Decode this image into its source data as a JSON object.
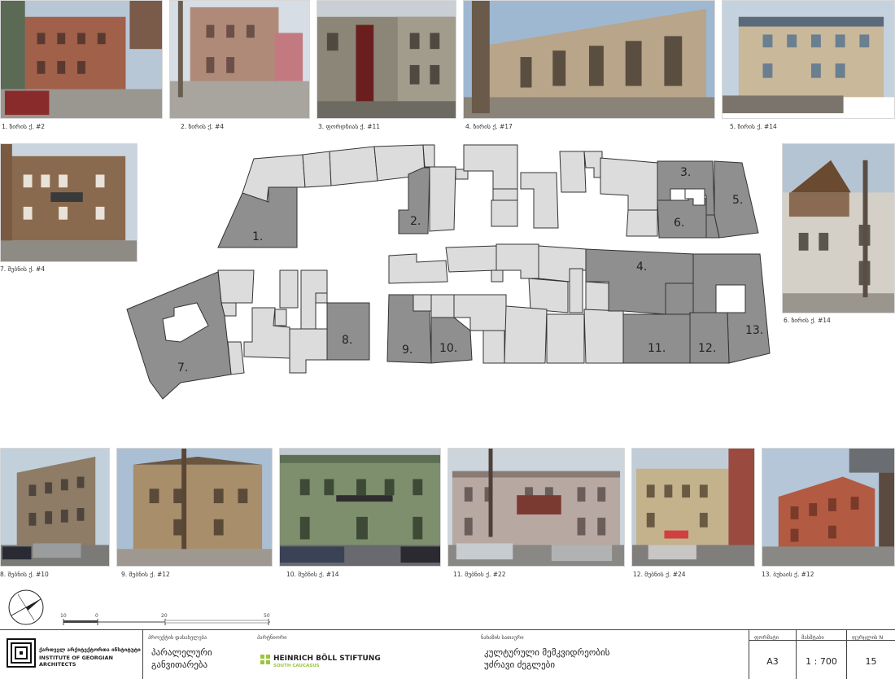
{
  "photos": [
    {
      "num": "1",
      "caption": "1. ზირის ქ. #2"
    },
    {
      "num": "2",
      "caption": "2. ზირის ქ. #4"
    },
    {
      "num": "3",
      "caption": "3. ფორდნიას ქ. #11"
    },
    {
      "num": "4",
      "caption": "4. ზირის ქ. #17"
    },
    {
      "num": "5",
      "caption": "5. ზირის ქ. #14"
    },
    {
      "num": "6",
      "caption": "6. ზირის ქ. #14"
    },
    {
      "num": "7",
      "caption": "7. შუბნის ქ. #4"
    },
    {
      "num": "8",
      "caption": "8. შუბნის ქ. #10"
    },
    {
      "num": "9",
      "caption": "9. შუბნის ქ. #12"
    },
    {
      "num": "10",
      "caption": "10. შუბნის ქ. #14"
    },
    {
      "num": "11",
      "caption": "11. შუბნის ქ. #22"
    },
    {
      "num": "12",
      "caption": "12. შუბნის ქ. #24"
    },
    {
      "num": "13",
      "caption": "13. ბუხაის ქ. #12"
    }
  ],
  "map_labels": [
    "1.",
    "2.",
    "3.",
    "4.",
    "5.",
    "6.",
    "7.",
    "8.",
    "9.",
    "10.",
    "11.",
    "12.",
    "13."
  ],
  "scale_bar": {
    "ticks": [
      "10",
      "0",
      "20",
      "50"
    ]
  },
  "title_block": {
    "logo_line1": "ქართველ არქიტექტორთა ინსტიტუტი",
    "logo_line2": "INSTITUTE OF GEORGIAN ARCHITECTS",
    "project_label": "პროექტის დასახელება",
    "project_value_1": "პარალელური",
    "project_value_2": "განვითარება",
    "partner_label": "პარტნიორი",
    "partner_name": "HEINRICH BÖLL STIFTUNG",
    "partner_sub": "SOUTH CAUCASUS",
    "sheet_label": "ნახაზის სათაური",
    "sheet_value_1": "კულტურული მემკვიდრეობის",
    "sheet_value_2": "უძრავი ძეგლები",
    "format_label": "ფორმატი",
    "format_value": "A3",
    "scale_label": "მასშტაბი",
    "scale_value": "1 : 700",
    "page_label": "ფურცლის N",
    "page_value": "15"
  },
  "colors": {
    "highlight": "#8f8f8f",
    "plain": "#dcdcdc",
    "outline": "#333333",
    "partner_green": "#9bc53d"
  }
}
